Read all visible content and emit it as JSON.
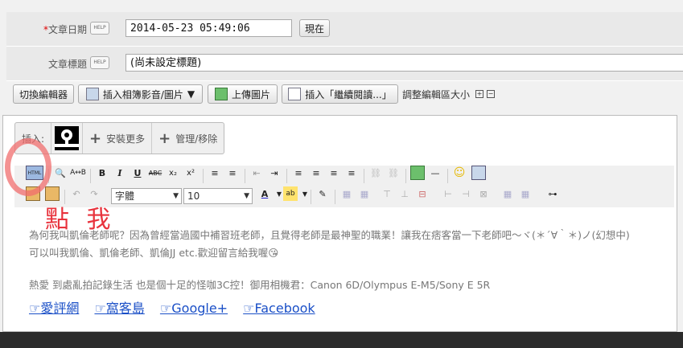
{
  "date_field": {
    "required_mark": "*",
    "label": "文章日期",
    "help": "HELP",
    "value": "2014-05-23 05:49:06",
    "now_button": "現在"
  },
  "title_field": {
    "label": "文章標題",
    "help": "HELP",
    "value": "(尚未設定標題)"
  },
  "toolbar": {
    "switch_editor": "切換編輯器",
    "insert_album": "插入相簿影音/圖片",
    "upload_image": "上傳圖片",
    "insert_more": "插入「繼續閱讀...」",
    "resize_label": "調整編輯區大小",
    "plus": "+",
    "minus": "−"
  },
  "insert_bar": {
    "label": "插入:",
    "install_more": "安裝更多",
    "manage": "管理/移除"
  },
  "editor_toolbar": {
    "html_btn": "HTML",
    "font_select": "字體",
    "size_select": "10"
  },
  "annotation": {
    "text": "點 我"
  },
  "content": {
    "para1": "為何我叫凱倫老師呢？因為曾經當過國中補習班老師，且覺得老師是最神聖的職業！讓我在痞客當一下老師吧～ヾ(＊´∀｀＊)ノ(幻想中)",
    "para2": "可以叫我凱倫、凱倫老師、凱倫JJ etc.歡迎留言給我喔😘",
    "para3": "熱愛 到處亂拍記錄生活 也是個十足的怪咖3C控！御用相機君：Canon 6D/Olympus E-M5/Sony E 5R",
    "links": [
      "☞愛評網",
      "☞窩客島",
      "☞Google+",
      "☞Facebook"
    ]
  }
}
